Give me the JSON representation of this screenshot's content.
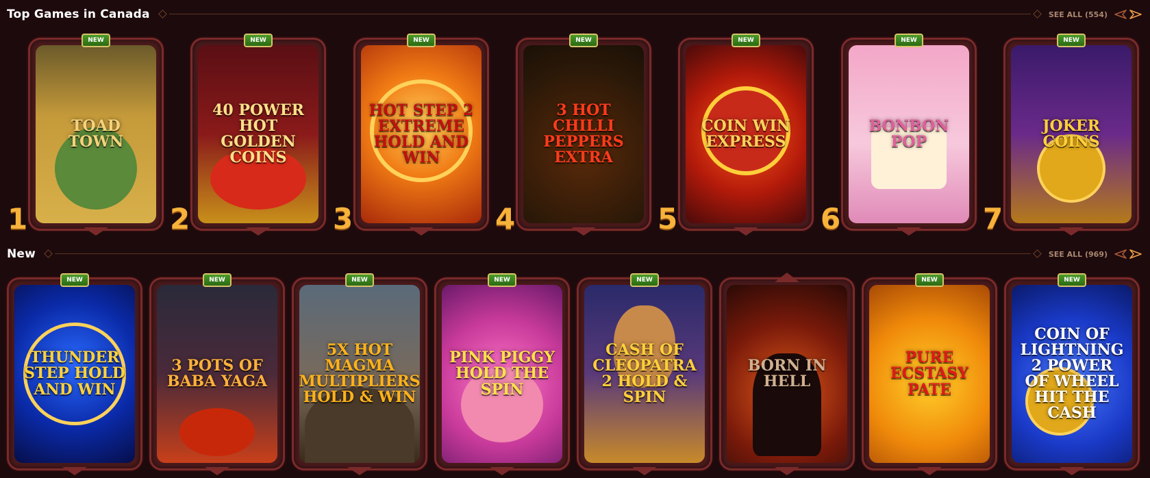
{
  "sections": [
    {
      "title": "Top Games in Canada",
      "see_all": "SEE ALL (554)",
      "games": [
        {
          "name": "TOAD TOWN",
          "badge": "NEW",
          "rank": "1",
          "bg": "linear-gradient(180deg,#6b5a2a 0%,#c59a3a 40%,#d8b04a 100%)",
          "fg": "#f4d27a"
        },
        {
          "name": "40 POWER HOT GOLDEN COINS",
          "badge": "NEW",
          "rank": "2",
          "bg": "linear-gradient(180deg,#5a0f14 0%,#8a1a1a 50%,#c8901a 100%)",
          "fg": "#ffe08a"
        },
        {
          "name": "HOT STEP 2 EXTREME HOLD AND WIN",
          "badge": "NEW",
          "rank": "3",
          "bg": "radial-gradient(circle at 50% 45%,#ffcf5a 0%,#f07a14 45%,#a82a0a 100%)",
          "fg": "#c21010"
        },
        {
          "name": "3 HOT CHILLI PEPPERS EXTRA",
          "badge": "NEW",
          "rank": "4",
          "bg": "radial-gradient(circle at 50% 60%,#5a2a0a 0%,#2a1808 70%,#1a1006 100%)",
          "fg": "#ff3b1a"
        },
        {
          "name": "COIN WIN EXPRESS",
          "badge": "NEW",
          "rank": "5",
          "bg": "radial-gradient(circle at 50% 50%,#ff5a1a 0%,#b31a0a 55%,#4a0a0a 100%)",
          "fg": "#ffd25a"
        },
        {
          "name": "BONBON POP",
          "badge": "NEW",
          "rank": "6",
          "bg": "linear-gradient(180deg,#f3a7c8 0%,#f7c9dc 55%,#e08ab8 100%)",
          "fg": "#e0609a"
        },
        {
          "name": "JOKER COINS",
          "badge": "NEW",
          "rank": "7",
          "bg": "linear-gradient(180deg,#3a1a6a 0%,#6a2a8a 50%,#b47a1a 100%)",
          "fg": "#ffcf3a"
        }
      ]
    },
    {
      "title": "New",
      "see_all": "SEE ALL (969)",
      "games": [
        {
          "name": "THUNDER STEP HOLD AND WIN",
          "badge": "NEW",
          "bg": "radial-gradient(circle at 50% 45%,#2a6aff 0%,#0a2aa8 55%,#060e4a 100%)",
          "fg": "#ffd23a"
        },
        {
          "name": "3 POTS OF BABA YAGA",
          "badge": "NEW",
          "bg": "linear-gradient(180deg,#2a2a3a 0%,#4a2a3a 50%,#c8401a 100%)",
          "fg": "#ffb23a"
        },
        {
          "name": "5X HOT MAGMA MULTIPLIERS HOLD & WIN",
          "badge": "NEW",
          "bg": "linear-gradient(180deg,#5a6a7a 0%,#7a6a5a 55%,#3a2a1a 100%)",
          "fg": "#ffb21a"
        },
        {
          "name": "PINK PIGGY HOLD THE SPIN",
          "badge": "NEW",
          "bg": "radial-gradient(circle at 50% 55%,#ff7ac8 0%,#c83a9a 55%,#6a1a6a 100%)",
          "fg": "#ffe04a"
        },
        {
          "name": "CASH OF CLEOPATRA 2 HOLD & SPIN",
          "badge": "NEW",
          "bg": "linear-gradient(180deg,#2a2a6a 0%,#5a3a7a 50%,#c88a2a 100%)",
          "fg": "#ffcf3a"
        },
        {
          "name": "BORN IN HELL",
          "badge": "",
          "bg": "radial-gradient(circle at 50% 60%,#e05a1a 0%,#7a1a0a 55%,#2a0a06 100%)",
          "fg": "#d0b090"
        },
        {
          "name": "PURE ECSTASY PATE",
          "badge": "NEW",
          "bg": "radial-gradient(circle at 50% 55%,#ffcf2a 0%,#f08a0a 55%,#a84a06 100%)",
          "fg": "#e01a1a"
        },
        {
          "name": "COIN OF LIGHTNING 2 POWER OF WHEEL HIT THE CASH",
          "badge": "NEW",
          "bg": "radial-gradient(circle at 50% 55%,#4a7aff 0%,#1a3ac8 55%,#0a1a6a 100%)",
          "fg": "#ffffff"
        }
      ]
    }
  ],
  "colors": {
    "background": "#1d0a0c",
    "accent_rank": "#f7b23a",
    "badge_green": "#2b6a14",
    "frame": "#7a2a2a"
  }
}
